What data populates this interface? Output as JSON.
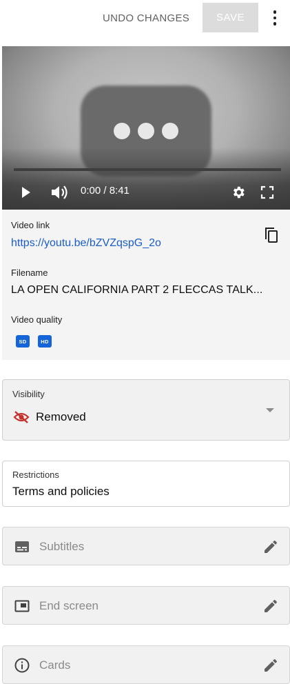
{
  "header": {
    "undo_label": "UNDO CHANGES",
    "save_label": "SAVE",
    "more_icon": "more-vert-icon"
  },
  "player": {
    "time_display": "0:00 / 8:41",
    "controls": [
      "play-icon",
      "volume-icon",
      "settings-icon",
      "fullscreen-icon"
    ]
  },
  "info": {
    "video_link_label": "Video link",
    "video_link": "https://youtu.be/bZVZqspG_2o",
    "filename_label": "Filename",
    "filename": "LA OPEN CALIFORNIA PART 2 FLECCAS TALK...",
    "quality_label": "Video quality",
    "quality_badges": [
      "SD",
      "HD"
    ]
  },
  "visibility": {
    "caption": "Visibility",
    "value": "Removed",
    "icon": "visibility-off-icon",
    "icon_color": "#c4302b"
  },
  "restrictions": {
    "caption": "Restrictions",
    "value": "Terms and policies"
  },
  "edit_rows": [
    {
      "label": "Subtitles",
      "icon": "subtitles-icon"
    },
    {
      "label": "End screen",
      "icon": "end-screen-icon"
    },
    {
      "label": "Cards",
      "icon": "info-icon"
    }
  ],
  "colors": {
    "link": "#1a5cc8",
    "badge": "#1565d8",
    "save_disabled": "#dcdcdc"
  }
}
